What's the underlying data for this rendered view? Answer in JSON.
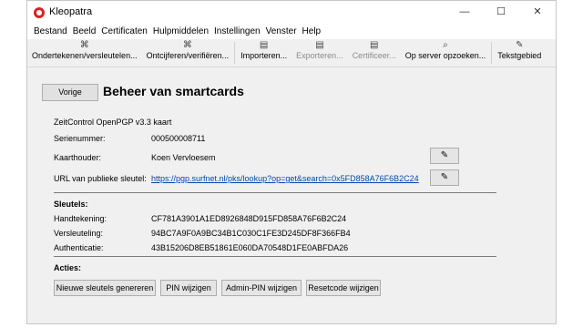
{
  "window": {
    "title": "Kleopatra",
    "icon": "kleopatra-icon"
  },
  "controls": {
    "minimize": "—",
    "maximize": "☐",
    "close": "✕"
  },
  "menu": [
    "Bestand",
    "Beeld",
    "Certificaten",
    "Hulpmiddelen",
    "Instellingen",
    "Venster",
    "Help"
  ],
  "toolbar": [
    {
      "label": "Ondertekenen/versleutelen...",
      "icon": "⌘"
    },
    {
      "label": "Ontcijferen/verifiëren...",
      "icon": "⌘"
    },
    {
      "label": "Importeren...",
      "icon": "▤"
    },
    {
      "label": "Exporteren...",
      "icon": "▤"
    },
    {
      "label": "Certificeer...",
      "icon": "▤"
    },
    {
      "label": "Op server opzoeken...",
      "icon": "⌕"
    },
    {
      "label": "Tekstgebied",
      "icon": "✎"
    }
  ],
  "page": {
    "back": "Vorige",
    "title": "Beheer van smartcards"
  },
  "card": {
    "type": "ZeitControl OpenPGP v3.3 kaart",
    "serial_label": "Serienummer:",
    "serial": "000500008711",
    "holder_label": "Kaarthouder:",
    "holder": "Koen Vervloesem",
    "url_label": "URL van publieke sleutel:",
    "url": "https://pgp.surfnet.nl/pks/lookup?op=get&search=0x5FD858A76F6B2C24"
  },
  "keys": {
    "heading": "Sleutels:",
    "items": [
      {
        "label": "Handtekening:",
        "value": "CF781A3901A1ED8926848D915FD858A76F6B2C24"
      },
      {
        "label": "Versleuteling:",
        "value": "94BC7A9F0A9BC34B1C030C1FE3D245DF8F366FB4"
      },
      {
        "label": "Authenticatie:",
        "value": "43B15206D8EB51861E060DA70548D1FE0ABFDA26"
      }
    ]
  },
  "actions": {
    "heading": "Acties:",
    "buttons": [
      "Nieuwe sleutels genereren",
      "PIN wijzigen",
      "Admin-PIN wijzigen",
      "Resetcode wijzigen"
    ]
  }
}
